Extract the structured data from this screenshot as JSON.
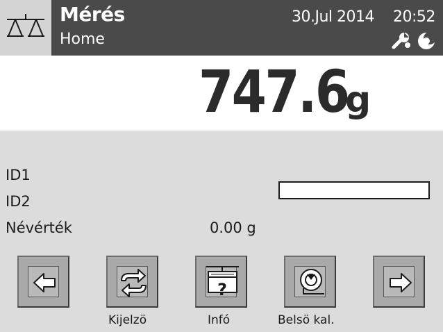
{
  "header": {
    "title": "Mérés",
    "subtitle": "Home",
    "date": "30.Jul 2014",
    "time": "20:52",
    "status_icons": [
      "wrench-icon",
      "moon-icon"
    ]
  },
  "weight": {
    "value": "747.6",
    "unit": "g"
  },
  "fields": {
    "id1_label": "ID1",
    "id2_label": "ID2",
    "target_label": "Névérték",
    "target_value": "0.00 g"
  },
  "buttons": {
    "left": {
      "icon": "arrow-left-icon"
    },
    "display": {
      "icon": "refresh-icon",
      "label": "Kijelzö"
    },
    "info": {
      "icon": "info-scale-icon",
      "label": "Infó"
    },
    "calibration": {
      "icon": "calibration-weight-icon",
      "label": "Belsö kal."
    },
    "right": {
      "icon": "arrow-right-icon"
    }
  }
}
